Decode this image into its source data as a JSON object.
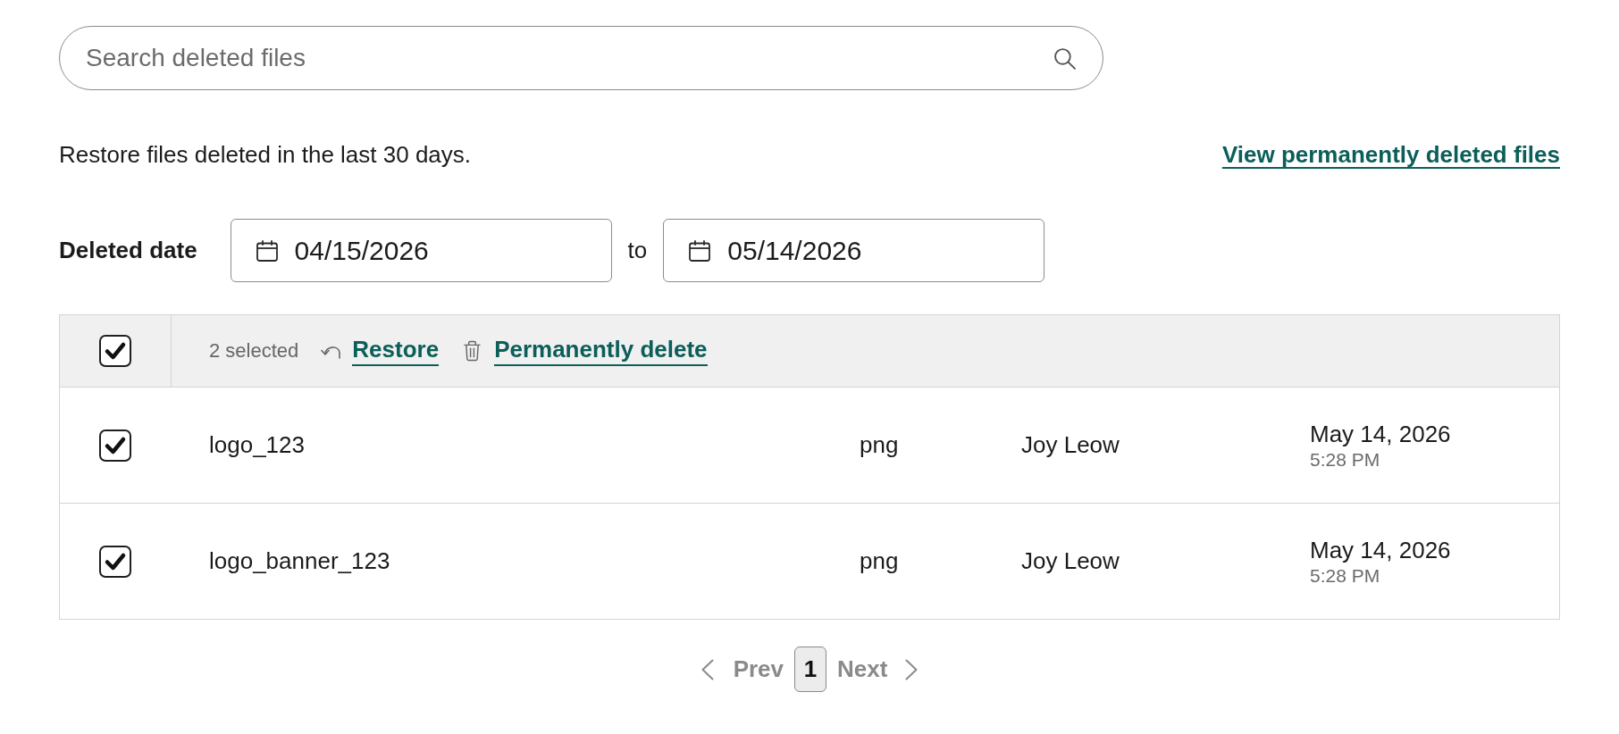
{
  "search": {
    "placeholder": "Search deleted files"
  },
  "intro": {
    "text": "Restore files deleted in the last 30 days.",
    "link": "View permanently deleted files"
  },
  "date_filter": {
    "label": "Deleted date",
    "from": "04/15/2026",
    "separator": "to",
    "to": "05/14/2026"
  },
  "table": {
    "select_all": {
      "checked": true
    },
    "selection_count": "2 selected",
    "actions": [
      {
        "kind": "restore",
        "label": "Restore"
      },
      {
        "kind": "delete",
        "label": "Permanently delete"
      }
    ],
    "rows": [
      {
        "checked": true,
        "name": "logo_123",
        "type": "png",
        "owner": "Joy Leow",
        "date": "May 14, 2026",
        "time": "5:28 PM"
      },
      {
        "checked": true,
        "name": "logo_banner_123",
        "type": "png",
        "owner": "Joy Leow",
        "date": "May 14, 2026",
        "time": "5:28 PM"
      }
    ]
  },
  "pagination": {
    "prev": {
      "label": "Prev",
      "disabled": true
    },
    "pages": [
      {
        "label": "1",
        "selected": true
      }
    ],
    "next": {
      "label": "Next",
      "disabled": true
    }
  }
}
